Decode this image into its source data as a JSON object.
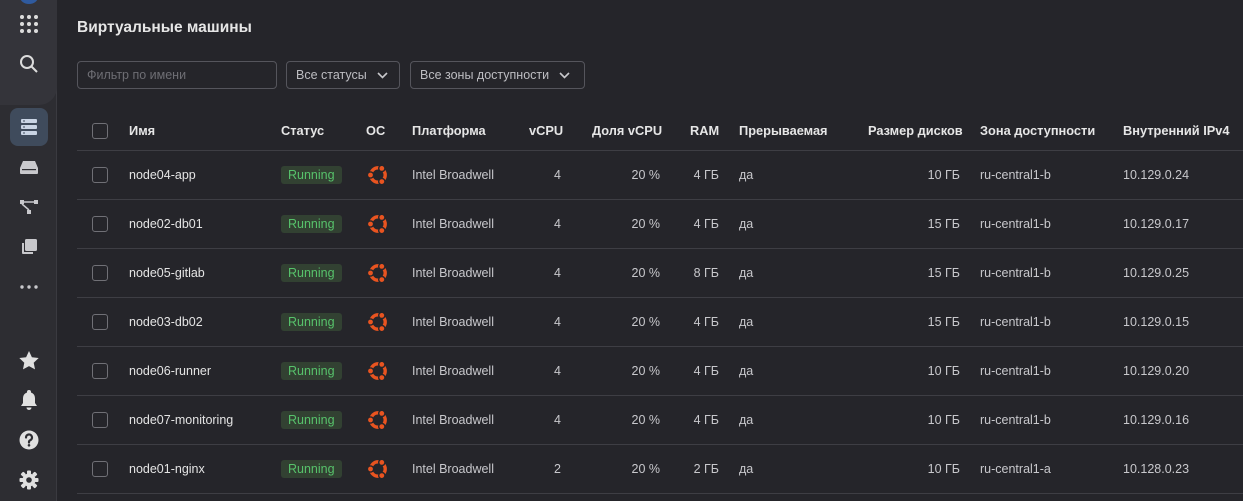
{
  "page": {
    "title": "Виртуальные машины"
  },
  "filters": {
    "name_placeholder": "Фильтр по имени",
    "status_select": "Все статусы",
    "zone_select": "Все зоны доступности"
  },
  "table": {
    "headers": {
      "name": "Имя",
      "status": "Статус",
      "os": "ОС",
      "platform": "Платформа",
      "vcpu": "vCPU",
      "cpu_share": "Доля vCPU",
      "ram": "RAM",
      "preemptible": "Прерываемая",
      "disk_size": "Размер дисков",
      "zone": "Зона доступности",
      "ipv4": "Внутренний IPv4"
    },
    "rows": [
      {
        "name": "node04-app",
        "status": "Running",
        "os": "ubuntu-icon",
        "platform": "Intel Broadwell",
        "vcpu": "4",
        "cpu_share": "20 %",
        "ram": "4 ГБ",
        "preemptible": "да",
        "disk_size": "10 ГБ",
        "zone": "ru-central1-b",
        "ipv4": "10.129.0.24"
      },
      {
        "name": "node02-db01",
        "status": "Running",
        "os": "ubuntu-icon",
        "platform": "Intel Broadwell",
        "vcpu": "4",
        "cpu_share": "20 %",
        "ram": "4 ГБ",
        "preemptible": "да",
        "disk_size": "15 ГБ",
        "zone": "ru-central1-b",
        "ipv4": "10.129.0.17"
      },
      {
        "name": "node05-gitlab",
        "status": "Running",
        "os": "ubuntu-icon",
        "platform": "Intel Broadwell",
        "vcpu": "4",
        "cpu_share": "20 %",
        "ram": "8 ГБ",
        "preemptible": "да",
        "disk_size": "15 ГБ",
        "zone": "ru-central1-b",
        "ipv4": "10.129.0.25"
      },
      {
        "name": "node03-db02",
        "status": "Running",
        "os": "ubuntu-icon",
        "platform": "Intel Broadwell",
        "vcpu": "4",
        "cpu_share": "20 %",
        "ram": "4 ГБ",
        "preemptible": "да",
        "disk_size": "15 ГБ",
        "zone": "ru-central1-b",
        "ipv4": "10.129.0.15"
      },
      {
        "name": "node06-runner",
        "status": "Running",
        "os": "ubuntu-icon",
        "platform": "Intel Broadwell",
        "vcpu": "4",
        "cpu_share": "20 %",
        "ram": "4 ГБ",
        "preemptible": "да",
        "disk_size": "10 ГБ",
        "zone": "ru-central1-b",
        "ipv4": "10.129.0.20"
      },
      {
        "name": "node07-monitoring",
        "status": "Running",
        "os": "ubuntu-icon",
        "platform": "Intel Broadwell",
        "vcpu": "4",
        "cpu_share": "20 %",
        "ram": "4 ГБ",
        "preemptible": "да",
        "disk_size": "10 ГБ",
        "zone": "ru-central1-b",
        "ipv4": "10.129.0.16"
      },
      {
        "name": "node01-nginx",
        "status": "Running",
        "os": "ubuntu-icon",
        "platform": "Intel Broadwell",
        "vcpu": "2",
        "cpu_share": "20 %",
        "ram": "2 ГБ",
        "preemptible": "да",
        "disk_size": "10 ГБ",
        "zone": "ru-central1-a",
        "ipv4": "10.128.0.23"
      }
    ]
  },
  "sidebar": {
    "items": [
      {
        "icon": "apps-grid-icon"
      },
      {
        "icon": "search-icon"
      },
      {
        "icon": "server-list-icon",
        "active": true
      },
      {
        "icon": "disk-icon"
      },
      {
        "icon": "network-icon"
      },
      {
        "icon": "copy-images-icon"
      },
      {
        "icon": "more-icon"
      },
      {
        "icon": "star-icon"
      },
      {
        "icon": "bell-icon"
      },
      {
        "icon": "help-icon"
      },
      {
        "icon": "settings-icon"
      }
    ]
  },
  "colors": {
    "background": "#25252a",
    "status_running_bg": "#324132",
    "status_running_text": "#57c26b",
    "ubuntu_orange": "#e95420",
    "active_nav": "#3f4b5c"
  }
}
